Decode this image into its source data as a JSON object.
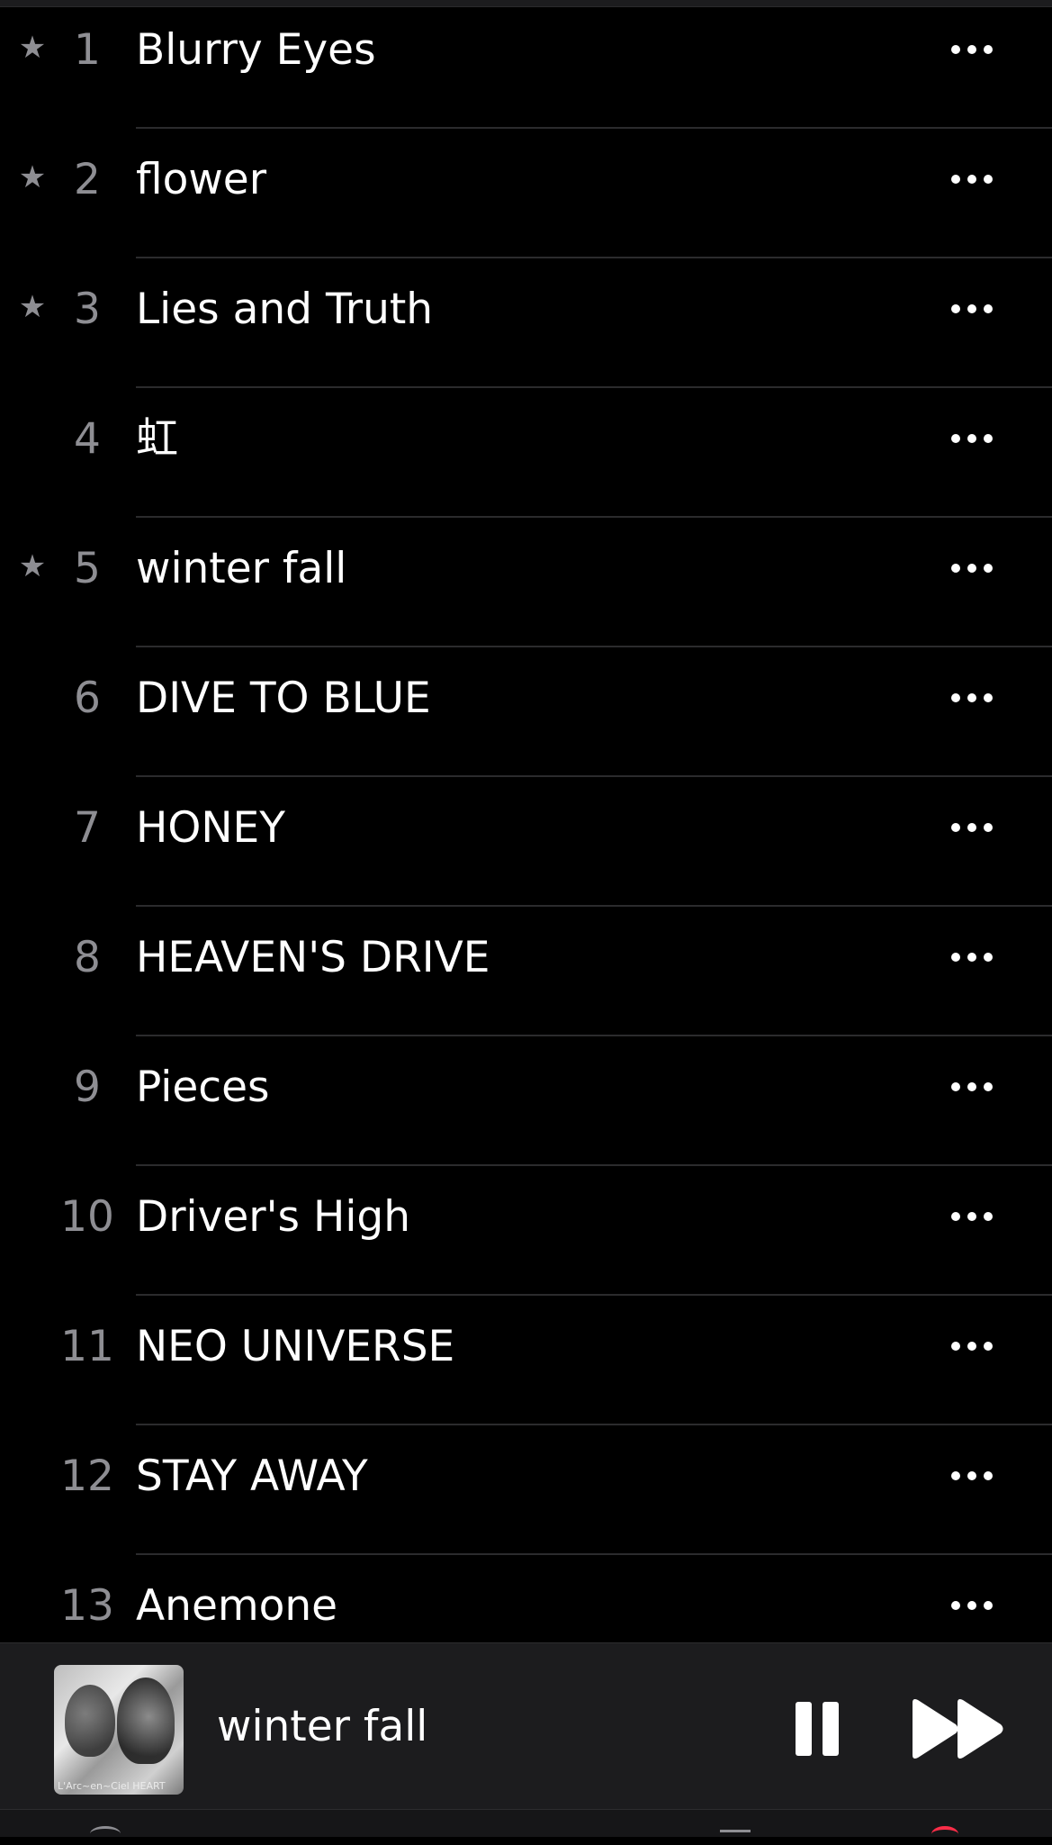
{
  "tracks": [
    {
      "number": "1",
      "title": "Blurry Eyes",
      "favorite": true
    },
    {
      "number": "2",
      "title": "flower",
      "favorite": true
    },
    {
      "number": "3",
      "title": "Lies and Truth",
      "favorite": true
    },
    {
      "number": "4",
      "title": "虹",
      "favorite": false
    },
    {
      "number": "5",
      "title": "winter fall",
      "favorite": true
    },
    {
      "number": "6",
      "title": "DIVE TO BLUE",
      "favorite": false
    },
    {
      "number": "7",
      "title": "HONEY",
      "favorite": false
    },
    {
      "number": "8",
      "title": "HEAVEN'S DRIVE",
      "favorite": false
    },
    {
      "number": "9",
      "title": "Pieces",
      "favorite": false
    },
    {
      "number": "10",
      "title": "Driver's High",
      "favorite": false
    },
    {
      "number": "11",
      "title": "NEO UNIVERSE",
      "favorite": false
    },
    {
      "number": "12",
      "title": "STAY AWAY",
      "favorite": false
    },
    {
      "number": "13",
      "title": "Anemone",
      "favorite": false
    }
  ],
  "star_glyph": "★",
  "now_playing": {
    "title": "winter fall",
    "artwork_text": "L'Arc~en~Ciel HEART",
    "state": "playing"
  },
  "colors": {
    "background": "#000000",
    "text_primary": "#ffffff",
    "text_secondary": "#8e8e93",
    "accent": "#fa2d48",
    "player_bg": "#1c1c1e"
  },
  "icons": {
    "more": "more-horizontal-icon",
    "pause": "pause-icon",
    "forward": "fast-forward-icon",
    "star": "star-icon"
  }
}
